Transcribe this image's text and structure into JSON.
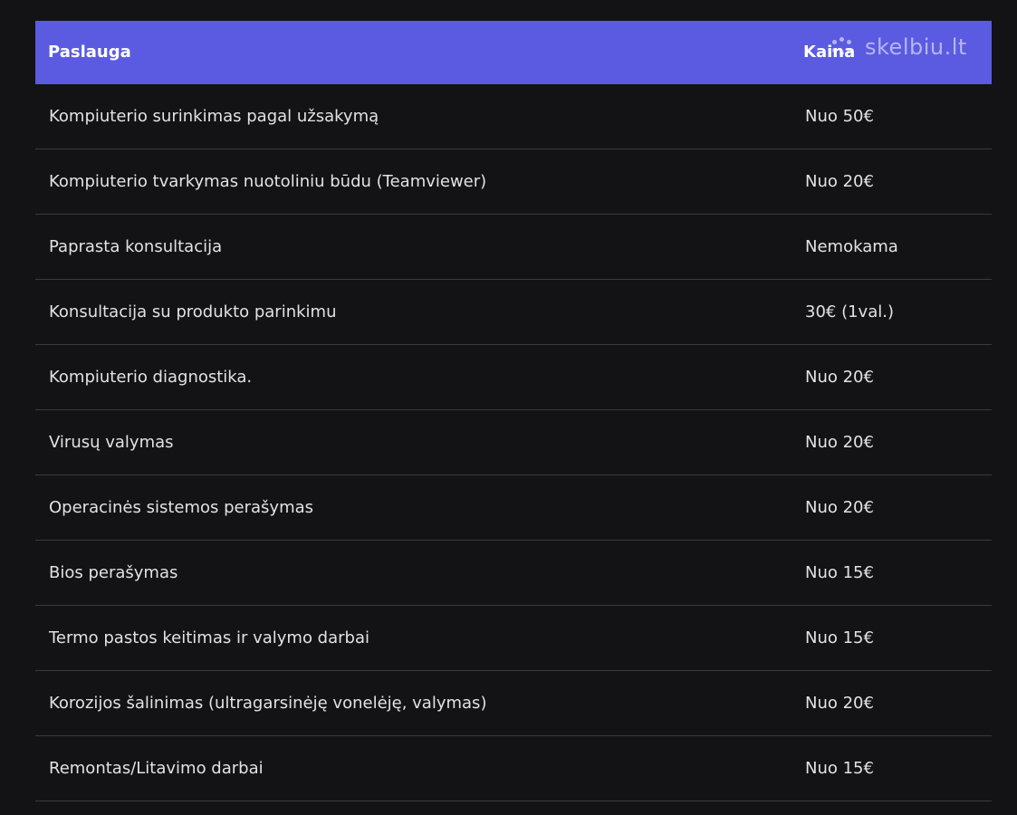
{
  "table": {
    "header": {
      "service_label": "Paslauga",
      "price_label": "Kaina"
    },
    "watermark": "skelbiu.lt",
    "rows": [
      {
        "service": "Kompiuterio surinkimas pagal užsakymą",
        "price": "Nuo 50€"
      },
      {
        "service": "Kompiuterio tvarkymas nuotoliniu būdu (Teamviewer)",
        "price": "Nuo 20€"
      },
      {
        "service": "Paprasta konsultacija",
        "price": "Nemokama"
      },
      {
        "service": "Konsultacija su produkto parinkimu",
        "price": "30€ (1val.)"
      },
      {
        "service": "Kompiuterio diagnostika.",
        "price": "Nuo 20€"
      },
      {
        "service": "Virusų valymas",
        "price": "Nuo 20€"
      },
      {
        "service": "Operacinės sistemos perašymas",
        "price": "Nuo 20€"
      },
      {
        "service": "Bios perašymas",
        "price": "Nuo 15€"
      },
      {
        "service": "Termo pastos keitimas ir valymo darbai",
        "price": "Nuo 15€"
      },
      {
        "service": "Korozijos šalinimas (ultragarsinėję vonelėję, valymas)",
        "price": "Nuo 20€"
      },
      {
        "service": "Remontas/Litavimo darbai",
        "price": "Nuo 15€"
      }
    ]
  },
  "colors": {
    "background": "#131315",
    "header_bg": "#5a5be0",
    "row_divider": "#3a3a3d",
    "text": "#e2e2e2"
  }
}
